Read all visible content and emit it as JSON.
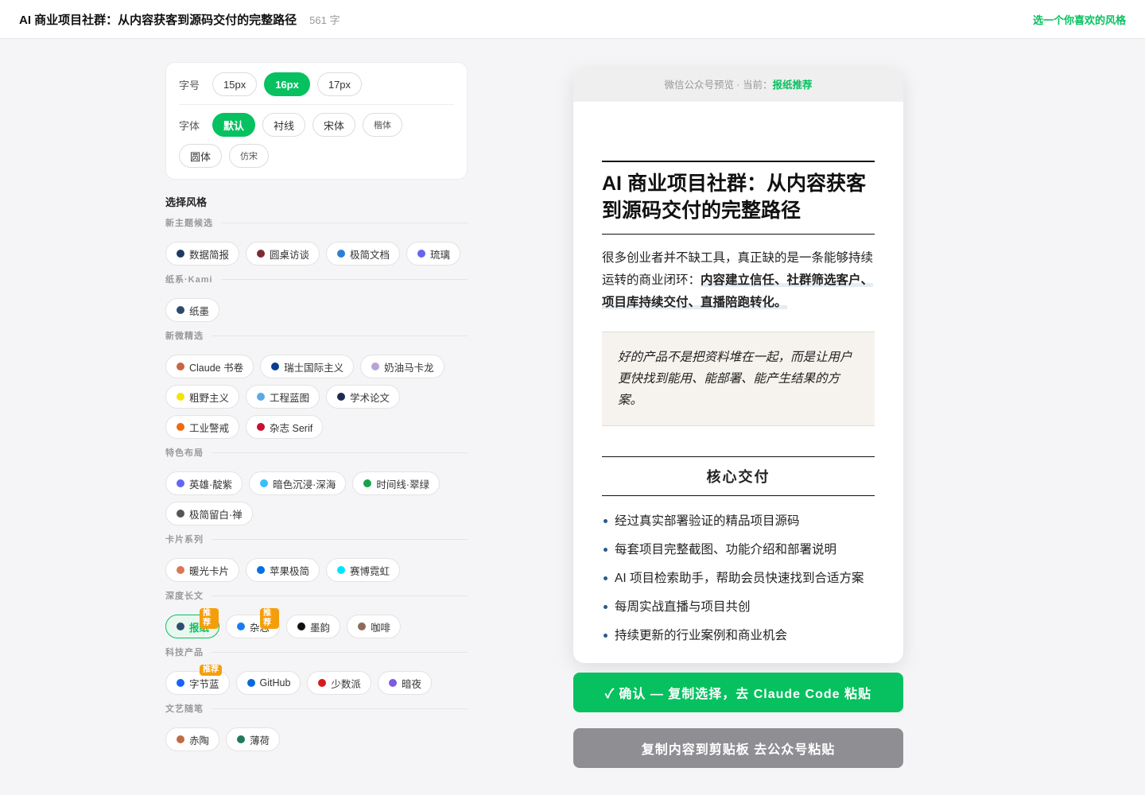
{
  "header": {
    "title": "AI 商业项目社群：从内容获客到源码交付的完整路径",
    "word_count": "561 字",
    "right_link": "选一个你喜欢的风格"
  },
  "options": {
    "size_label": "字号",
    "sizes": [
      "15px",
      "16px",
      "17px"
    ],
    "size_selected": "16px",
    "font_label": "字体",
    "fonts": [
      "默认",
      "衬线",
      "宋体",
      "楷体",
      "圆体",
      "仿宋"
    ],
    "font_selected": "默认"
  },
  "style_section_title": "选择风格",
  "badge_text": "推荐",
  "groups": [
    {
      "title": "新主题候选",
      "items": [
        {
          "label": "数据简报",
          "color": "#1f3a5f"
        },
        {
          "label": "圆桌访谈",
          "color": "#7a2e2e"
        },
        {
          "label": "极简文档",
          "color": "#2b7fd6"
        },
        {
          "label": "琉璃",
          "color": "#6366f1"
        }
      ]
    },
    {
      "title": "纸系·Kami",
      "items": [
        {
          "label": "纸墨",
          "color": "#2c4a6e"
        }
      ]
    },
    {
      "title": "新微精选",
      "items": [
        {
          "label": "Claude 书卷",
          "color": "#c96442"
        },
        {
          "label": "瑞士国际主义",
          "color": "#0a3d91"
        },
        {
          "label": "奶油马卡龙",
          "color": "#b6a4d6"
        },
        {
          "label": "粗野主义",
          "color": "#f5e400"
        },
        {
          "label": "工程蓝图",
          "color": "#5aa9e6"
        },
        {
          "label": "学术论文",
          "color": "#1c2c4c"
        },
        {
          "label": "工业警戒",
          "color": "#f06a0a"
        },
        {
          "label": "杂志 Serif",
          "color": "#c8102e"
        }
      ]
    },
    {
      "title": "特色布局",
      "items": [
        {
          "label": "英雄·靛紫",
          "color": "#6366f1"
        },
        {
          "label": "暗色沉浸·深海",
          "color": "#38bdf8"
        },
        {
          "label": "时间线·翠绿",
          "color": "#16a34a"
        },
        {
          "label": "极简留白·禅",
          "color": "#555555"
        }
      ]
    },
    {
      "title": "卡片系列",
      "items": [
        {
          "label": "暖光卡片",
          "color": "#d97757"
        },
        {
          "label": "苹果极简",
          "color": "#0071e3"
        },
        {
          "label": "赛博霓虹",
          "color": "#00e5ff"
        }
      ]
    },
    {
      "title": "深度长文",
      "items": [
        {
          "label": "报纸",
          "color": "#2f4f6f",
          "selected": true,
          "badge": true
        },
        {
          "label": "杂志",
          "color": "#1d7bf2",
          "badge": true
        },
        {
          "label": "墨韵",
          "color": "#111111"
        },
        {
          "label": "咖啡",
          "color": "#8b6b5a"
        }
      ]
    },
    {
      "title": "科技产品",
      "items": [
        {
          "label": "字节蓝",
          "color": "#1664ff",
          "badge": true
        },
        {
          "label": "GitHub",
          "color": "#0969da"
        },
        {
          "label": "少数派",
          "color": "#d71a1b"
        },
        {
          "label": "暗夜",
          "color": "#7c5ce0"
        }
      ]
    },
    {
      "title": "文艺随笔",
      "items": [
        {
          "label": "赤陶",
          "color": "#c06a45"
        },
        {
          "label": "薄荷",
          "color": "#1f7a5a"
        }
      ]
    }
  ],
  "preview": {
    "bar_prefix": "微信公众号预览 · 当前：",
    "bar_current": "报纸推荐",
    "title": "AI 商业项目社群：从内容获客到源码交付的完整路径",
    "intro_plain": "很多创业者并不缺工具，真正缺的是一条能够持续运转的商业闭环：",
    "intro_highlight": "内容建立信任、社群筛选客户、项目库持续交付、直播陪跑转化。",
    "quote": "好的产品不是把资料堆在一起，而是让用户更快找到能用、能部署、能产生结果的方案。",
    "section_title": "核心交付",
    "list": [
      "经过真实部署验证的精品项目源码",
      "每套项目完整截图、功能介绍和部署说明",
      "AI 项目检索助手，帮助会员快速找到合适方案",
      "每周实战直播与项目共创",
      "持续更新的行业案例和商业机会"
    ]
  },
  "buttons": {
    "confirm": "✓ 确认 — 复制选择，去 Claude Code 粘贴",
    "copy": "复制内容到剪贴板 去公众号粘贴"
  },
  "colors": {
    "accent": "#07c160",
    "badge": "#f59e0b",
    "copy_button": "#8e8e93"
  }
}
